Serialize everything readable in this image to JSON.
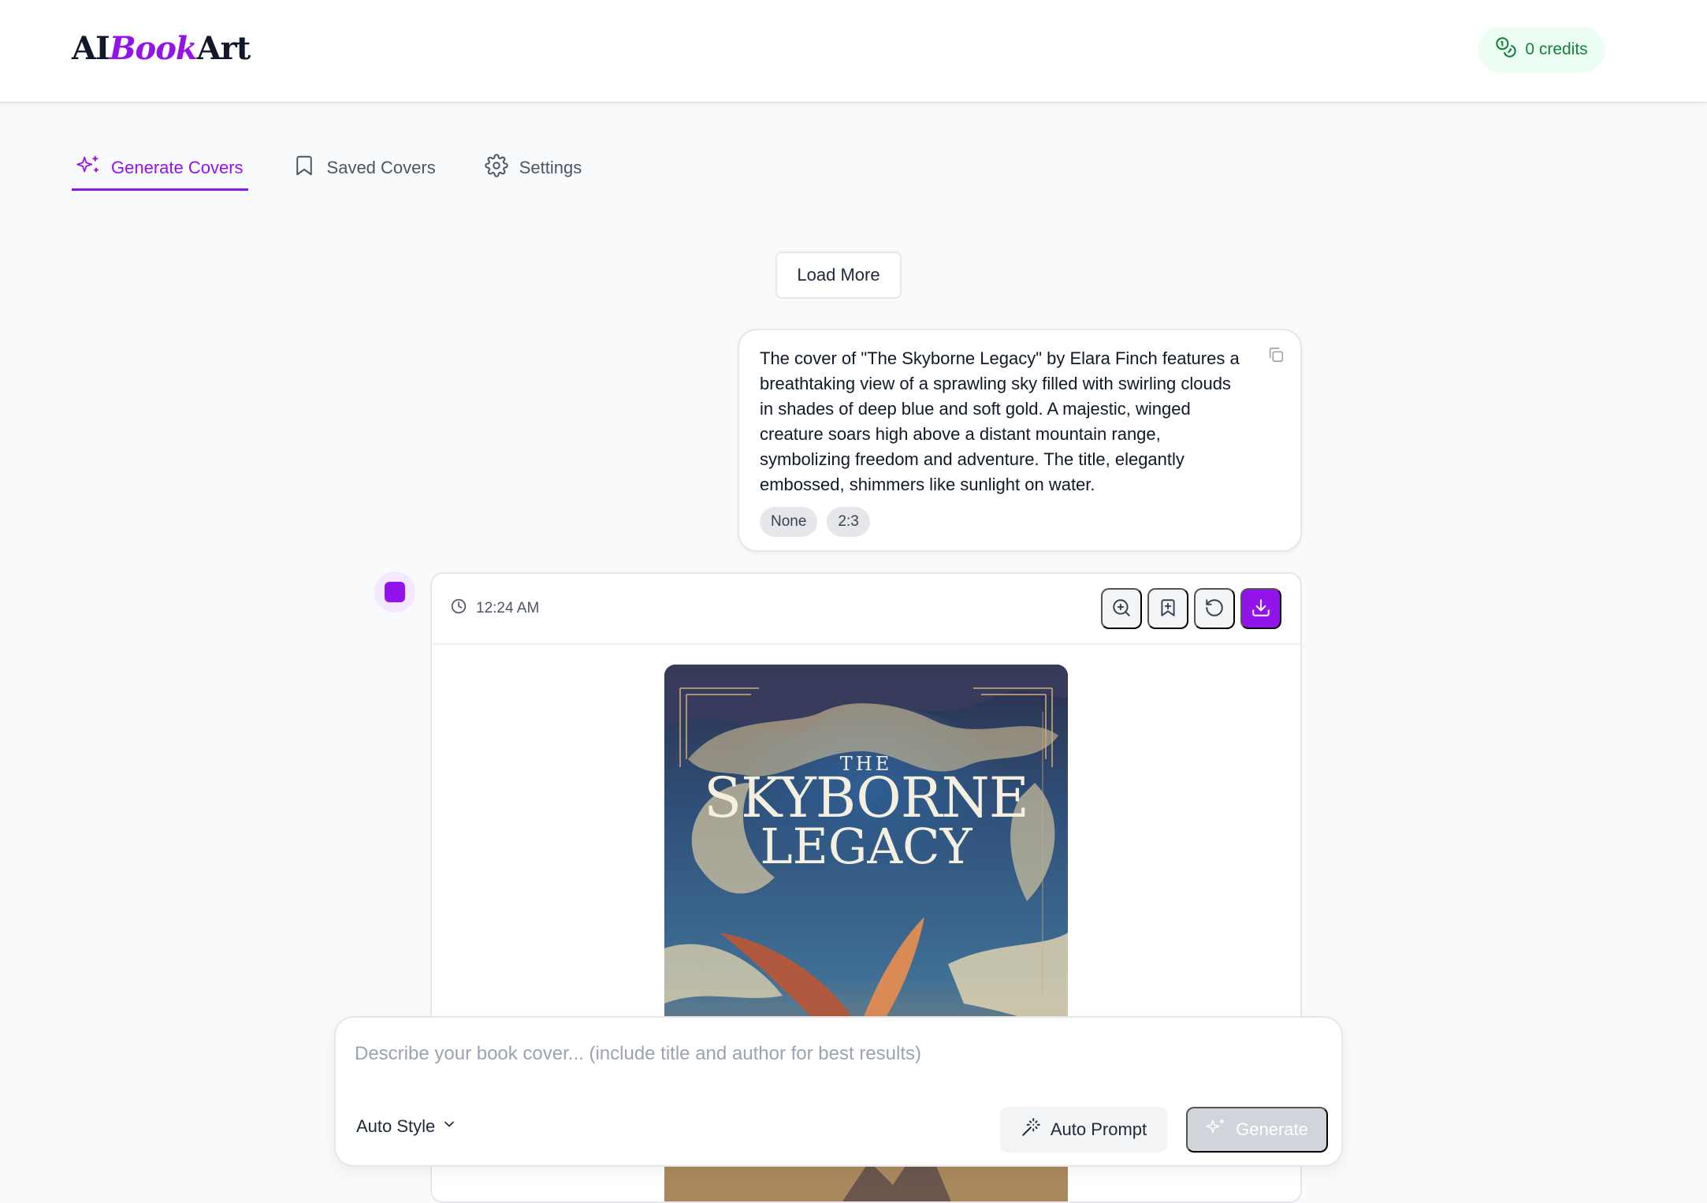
{
  "app": {
    "logo_prefix": "AI",
    "logo_middle": "Book",
    "logo_suffix": "Art",
    "credits_label": "0 credits"
  },
  "tabs": [
    {
      "label": "Generate Covers",
      "icon": "sparkles-icon",
      "active": true
    },
    {
      "label": "Saved Covers",
      "icon": "bookmark-icon",
      "active": false
    },
    {
      "label": "Settings",
      "icon": "gear-icon",
      "active": false
    }
  ],
  "feed": {
    "load_more_label": "Load More",
    "prompt": {
      "text": "The cover of \"The Skyborne Legacy\" by Elara Finch features a breathtaking view of a sprawling sky filled with swirling clouds in shades of deep blue and soft gold. A majestic, winged creature soars high above a distant mountain range, symbolizing freedom and adventure. The title, elegantly embossed, shimmers like sunlight on water.",
      "chips": [
        "None",
        "2:3"
      ]
    },
    "result": {
      "time": "12:24 AM",
      "actions": [
        "zoom-in-icon",
        "bookmark-plus-icon",
        "regenerate-icon",
        "download-icon"
      ],
      "cover_title_small": "THE",
      "cover_title_line1": "SKYBORNE",
      "cover_title_line2": "LEGACY"
    }
  },
  "composer": {
    "placeholder": "Describe your book cover... (include title and author for best results)",
    "value": "",
    "style_label": "Auto Style",
    "auto_prompt_label": "Auto Prompt",
    "generate_label": "Generate"
  },
  "colors": {
    "accent": "#9314ea",
    "credits_text": "#15803d",
    "credits_bg": "#ecfdf3"
  }
}
